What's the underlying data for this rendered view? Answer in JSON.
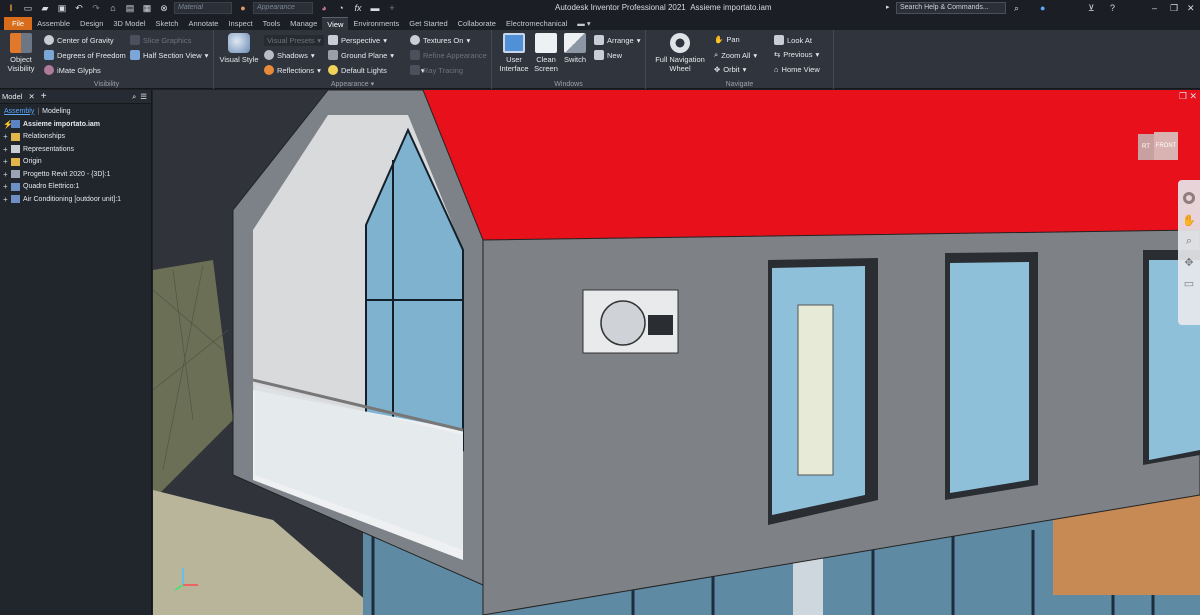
{
  "titlebar": {
    "app_title": "Autodesk Inventor Professional 2021",
    "doc_title": "Assieme importato.iam",
    "material_placeholder": "Material",
    "appearance_placeholder": "Appearance",
    "search_placeholder": "Search Help & Commands...",
    "fx_label": "fx"
  },
  "tabs": [
    {
      "label": "File"
    },
    {
      "label": "Assemble"
    },
    {
      "label": "Design"
    },
    {
      "label": "3D Model"
    },
    {
      "label": "Sketch"
    },
    {
      "label": "Annotate"
    },
    {
      "label": "Inspect"
    },
    {
      "label": "Tools"
    },
    {
      "label": "Manage"
    },
    {
      "label": "View"
    },
    {
      "label": "Environments"
    },
    {
      "label": "Get Started"
    },
    {
      "label": "Collaborate"
    },
    {
      "label": "Electromechanical"
    }
  ],
  "ribbon": {
    "visibility": {
      "title": "Visibility",
      "object_visibility": "Object Visibility",
      "center_of_gravity": "Center of Gravity",
      "degrees_of_freedom": "Degrees of Freedom",
      "imate_glyphs": "iMate Glyphs",
      "slice_graphics": "Slice Graphics",
      "half_section_view": "Half Section View"
    },
    "appearance": {
      "title": "Appearance",
      "visual_style": "Visual Style",
      "visual_presets": "Visual Presets",
      "shadows": "Shadows",
      "reflections": "Reflections",
      "perspective": "Perspective",
      "ground_plane": "Ground Plane",
      "default_lights": "Default Lights",
      "textures_on": "Textures On",
      "refine_appearance": "Refine Appearance",
      "ray_tracing": "Ray Tracing"
    },
    "windows": {
      "title": "Windows",
      "user_interface": "User Interface",
      "clean_screen": "Clean Screen",
      "switch": "Switch",
      "arrange": "Arrange",
      "new": "New"
    },
    "navigate": {
      "title": "Navigate",
      "full_navigation_wheel": "Full Navigation Wheel",
      "pan": "Pan",
      "zoom_all": "Zoom All",
      "orbit": "Orbit",
      "look_at": "Look At",
      "previous": "Previous",
      "home_view": "Home View"
    }
  },
  "browser": {
    "tab_label": "Model",
    "subtab_assembly": "Assembly",
    "subtab_modeling": "Modeling",
    "tree": [
      {
        "label": "Assieme importato.iam",
        "bold": true
      },
      {
        "label": "Relationships"
      },
      {
        "label": "Representations"
      },
      {
        "label": "Origin"
      },
      {
        "label": "Progetto Revit 2020 - {3D}:1"
      },
      {
        "label": "Quadro Elettrico:1"
      },
      {
        "label": "Air Conditioning [outdoor unit]:1"
      }
    ]
  },
  "viewcube": {
    "left_face": "RT",
    "front_face": "FRONT"
  },
  "colors": {
    "accent": "#d86c1a",
    "roof": "#e8101a",
    "ribbon_bg": "#2f343d",
    "browser_bg": "#21252c",
    "link": "#5aa9ff"
  },
  "icons": [
    "inventor-logo-icon",
    "new-icon",
    "open-icon",
    "save-icon",
    "undo-icon",
    "redo-icon",
    "home-icon",
    "update-icon",
    "select-icon",
    "color-icon",
    "help-icon",
    "user-icon",
    "cart-icon",
    "minimize-icon",
    "restore-icon",
    "close-icon",
    "search-icon",
    "menu-icon",
    "plus-icon",
    "gizmo-icon"
  ]
}
